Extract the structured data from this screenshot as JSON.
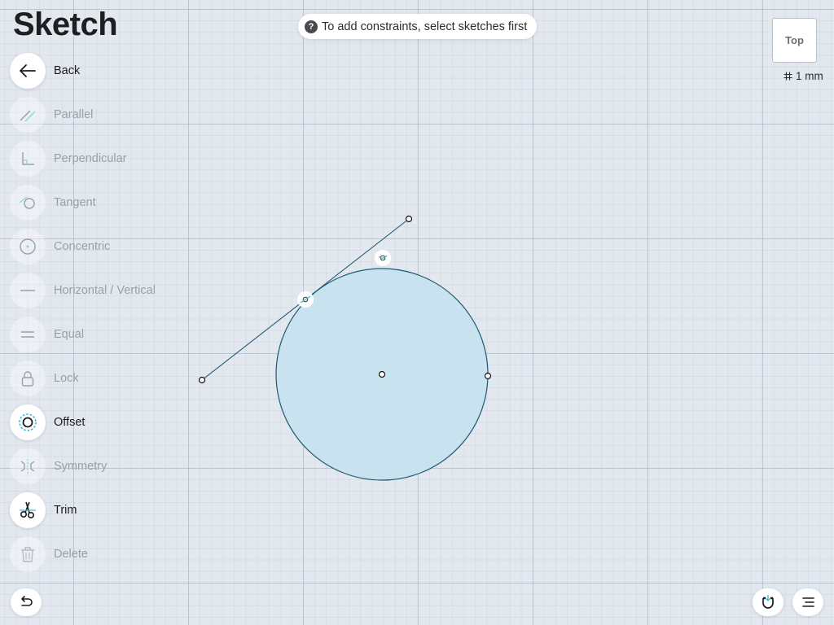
{
  "header": {
    "title": "Sketch"
  },
  "hint": {
    "icon": "?",
    "text": "To add constraints, select sketches first"
  },
  "toolbar": {
    "items": [
      {
        "name": "back",
        "label": "Back",
        "state": "active",
        "icon": "arrow-left-icon"
      },
      {
        "name": "parallel",
        "label": "Parallel",
        "state": "disabled",
        "icon": "parallel-icon"
      },
      {
        "name": "perpendicular",
        "label": "Perpendicular",
        "state": "disabled",
        "icon": "perpendicular-icon"
      },
      {
        "name": "tangent",
        "label": "Tangent",
        "state": "disabled",
        "icon": "tangent-icon"
      },
      {
        "name": "concentric",
        "label": "Concentric",
        "state": "disabled",
        "icon": "concentric-icon"
      },
      {
        "name": "horizontal-vertical",
        "label": "Horizontal / Vertical",
        "state": "disabled",
        "icon": "horizontal-line-icon"
      },
      {
        "name": "equal",
        "label": "Equal",
        "state": "disabled",
        "icon": "equal-icon"
      },
      {
        "name": "lock",
        "label": "Lock",
        "state": "disabled",
        "icon": "lock-icon"
      },
      {
        "name": "offset",
        "label": "Offset",
        "state": "active",
        "icon": "offset-icon"
      },
      {
        "name": "symmetry",
        "label": "Symmetry",
        "state": "disabled",
        "icon": "symmetry-icon"
      },
      {
        "name": "trim",
        "label": "Trim",
        "state": "active",
        "icon": "scissors-icon"
      },
      {
        "name": "delete",
        "label": "Delete",
        "state": "disabled",
        "icon": "trash-icon"
      }
    ]
  },
  "viewcube": {
    "label": "Top"
  },
  "grid": {
    "icon": "grid-hash-icon",
    "size_label": "1 mm"
  },
  "bottom_controls": {
    "undo_icon": "undo-icon",
    "snap_icon": "magnet-icon",
    "menu_icon": "menu-lines-icon"
  },
  "colors": {
    "background": "#e3e8ef",
    "sketch_stroke": "#1e5a72",
    "circle_fill": "#c8e3ef",
    "accent": "#39b7d6",
    "text_active": "#1c1c1e",
    "text_disabled": "#9aa0a8"
  }
}
